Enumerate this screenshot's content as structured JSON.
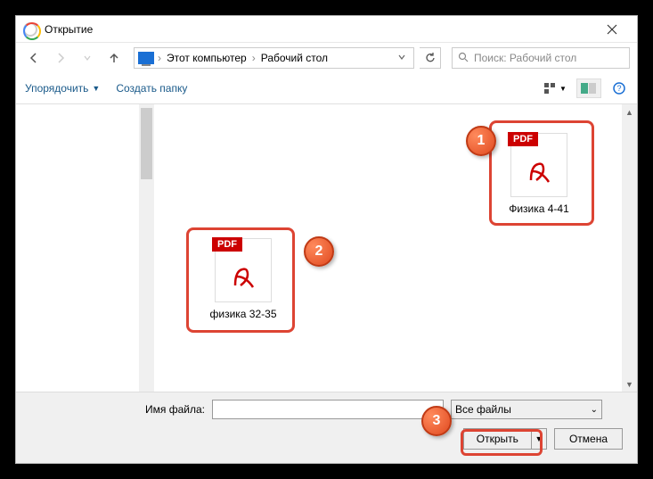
{
  "window": {
    "title": "Открытие"
  },
  "nav": {
    "breadcrumb": [
      "Этот компьютер",
      "Рабочий стол"
    ]
  },
  "search": {
    "placeholder": "Поиск: Рабочий стол"
  },
  "toolbar": {
    "organize": "Упорядочить",
    "new_folder": "Создать папку"
  },
  "files": [
    {
      "name": "Физика 4-41",
      "type": "pdf",
      "badge": "PDF"
    },
    {
      "name": "физика 32-35",
      "type": "pdf",
      "badge": "PDF"
    }
  ],
  "bottom": {
    "filename_label": "Имя файла:",
    "filename_value": "",
    "filetype": "Все файлы",
    "open": "Открыть",
    "cancel": "Отмена"
  },
  "callouts": [
    "1",
    "2",
    "3"
  ]
}
